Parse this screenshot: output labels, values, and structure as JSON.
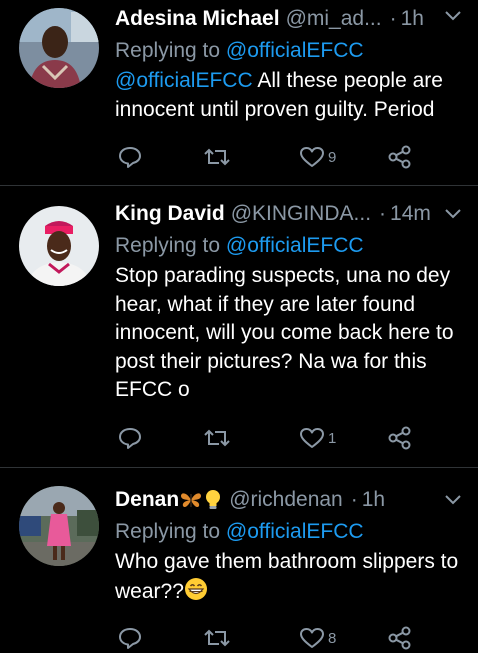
{
  "tweets": [
    {
      "name": "Adesina Michael",
      "handle": "@mi_ad...",
      "dot": "·",
      "time": "1h",
      "replying_prefix": "Replying to",
      "replying_to": "@officialEFCC",
      "mention": "@officialEFCC",
      "text": " All these people are innocent until proven guilty. Period",
      "likes": "9"
    },
    {
      "name": "King David",
      "handle": "@KINGINDA...",
      "dot": "·",
      "time": "14m",
      "replying_prefix": "Replying to",
      "replying_to": "@officialEFCC",
      "text": "Stop parading suspects, una no dey hear, what if they are later found innocent, will you come back here to post their pictures? Na wa for this EFCC o",
      "likes": "1"
    },
    {
      "name": "Denan",
      "name_emojis": [
        "butterfly",
        "light-bulb"
      ],
      "handle": "@richdenan",
      "dot": "·",
      "time": "1h",
      "replying_prefix": "Replying to",
      "replying_to": "@officialEFCC",
      "text": "Who gave them bathroom slippers to wear??",
      "text_emoji": "grinning-face",
      "likes": "8"
    }
  ],
  "colors": {
    "background": "#000000",
    "secondary_text": "#8b98a5",
    "link": "#1d9bf0",
    "divider": "#2f3336"
  },
  "icons": [
    "reply-icon",
    "retweet-icon",
    "like-icon",
    "share-icon",
    "chevron-down-icon"
  ]
}
